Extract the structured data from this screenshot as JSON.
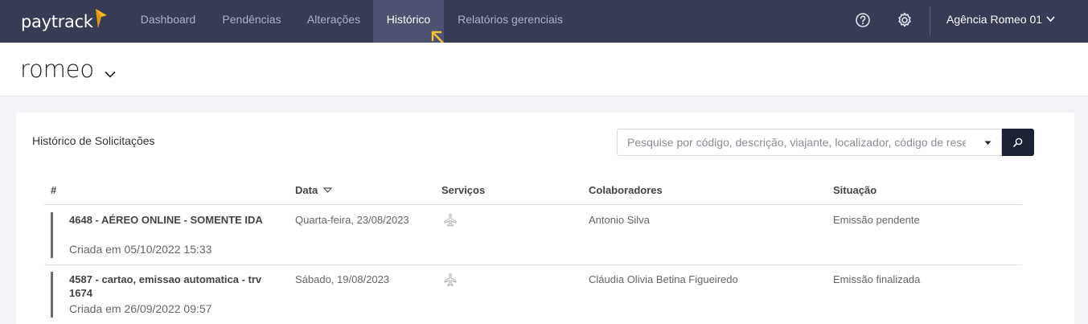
{
  "brand": {
    "logo_text": "paytrack",
    "accent": "#f5b820"
  },
  "nav": {
    "items": [
      {
        "label": "Dashboard",
        "active": false
      },
      {
        "label": "Pendências",
        "active": false
      },
      {
        "label": "Alterações",
        "active": false
      },
      {
        "label": "Histórico",
        "active": true
      },
      {
        "label": "Relatórios gerenciais",
        "active": false
      }
    ],
    "agency": "Agência Romeo 01"
  },
  "page": {
    "title": "romeo"
  },
  "history": {
    "title": "Histórico de Solicitações",
    "search_placeholder": "Pesquise por código, descrição, viajante, localizador, código de reserva",
    "columns": {
      "id": "#",
      "date": "Data",
      "services": "Serviços",
      "collaborators": "Colaboradores",
      "status": "Situação"
    },
    "rows": [
      {
        "title": "4648                - AÉREO ONLINE - SOMENTE IDA",
        "created": "Criada em 05/10/2022 15:33",
        "date": "Quarta-feira, 23/08/2023",
        "service_icon": "airplane-icon",
        "collaborator": "Antonio Silva",
        "status": "Emissão pendente"
      },
      {
        "title": "4587 - cartao, emissao automatica - trv 1674",
        "created": "Criada em 26/09/2022 09:57",
        "date": "Sábado, 19/08/2023",
        "service_icon": "airplane-icon",
        "collaborator": "Cláudia Olivia Betina Figueiredo",
        "status": "Emissão finalizada"
      }
    ]
  }
}
